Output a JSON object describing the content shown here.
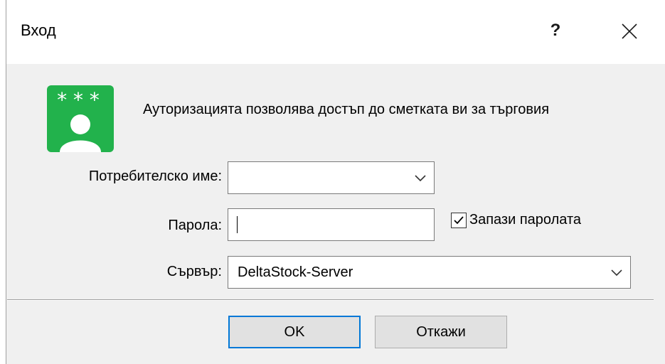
{
  "window": {
    "title": "Вход",
    "help_label": "?"
  },
  "logo": {
    "icon": "user-password-icon",
    "stars": "***",
    "color": "#22b24c"
  },
  "info": {
    "text": "Ауторизацията позволява достъп до сметката ви за търговия"
  },
  "form": {
    "username": {
      "label": "Потребителско име:",
      "value": ""
    },
    "password": {
      "label": "Парола:",
      "value": ""
    },
    "save_password": {
      "label": "Запази паролата",
      "checked": true
    },
    "server": {
      "label": "Сървър:",
      "value": "DeltaStock-Server"
    }
  },
  "buttons": {
    "ok": "OK",
    "cancel": "Откажи"
  },
  "colors": {
    "accent": "#0078d7"
  }
}
